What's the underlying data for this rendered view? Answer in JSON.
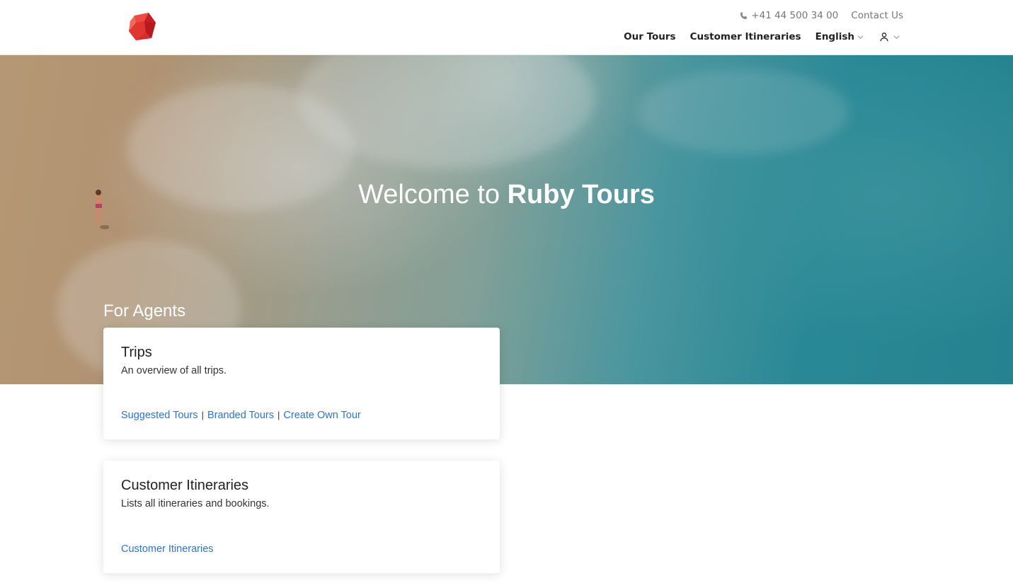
{
  "header": {
    "logo_icon": "ruby-logo-icon",
    "phone_icon": "phone-icon",
    "phone": "+41 44 500 34 00",
    "contact_label": "Contact Us",
    "nav": {
      "tours_label": "Our Tours",
      "itineraries_label": "Customer Itineraries",
      "language_label": "English",
      "user_icon": "user-icon"
    }
  },
  "hero": {
    "title_prefix": "Welcome to",
    "title_brand": "Ruby Tours",
    "section_title": "For Agents"
  },
  "cards": {
    "trips": {
      "title": "Trips",
      "description": "An overview of all trips.",
      "links": {
        "suggested": "Suggested Tours",
        "branded": "Branded Tours",
        "create": "Create Own Tour"
      },
      "separator": "|"
    },
    "itineraries": {
      "title": "Customer Itineraries",
      "description": "Lists all itineraries and bookings.",
      "link": "Customer Itineraries"
    }
  },
  "colors": {
    "link": "#2a74d6",
    "brand_red": "#d92b2b"
  }
}
